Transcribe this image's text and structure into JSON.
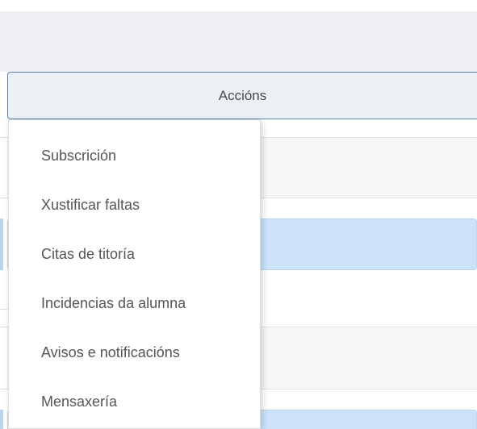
{
  "actions_button": {
    "label": "Accións"
  },
  "dropdown": {
    "items": [
      {
        "label": "Subscrición"
      },
      {
        "label": "Xustificar faltas"
      },
      {
        "label": "Citas de titoría"
      },
      {
        "label": "Incidencias da alumna"
      },
      {
        "label": "Avisos e notificacións"
      },
      {
        "label": "Mensaxería"
      }
    ]
  },
  "colors": {
    "button_border": "#5b82b3",
    "button_bg": "#ebf0f5",
    "highlight_row": "#cde3f9",
    "grey_row": "#f6f6f6",
    "menu_text": "#555555"
  }
}
